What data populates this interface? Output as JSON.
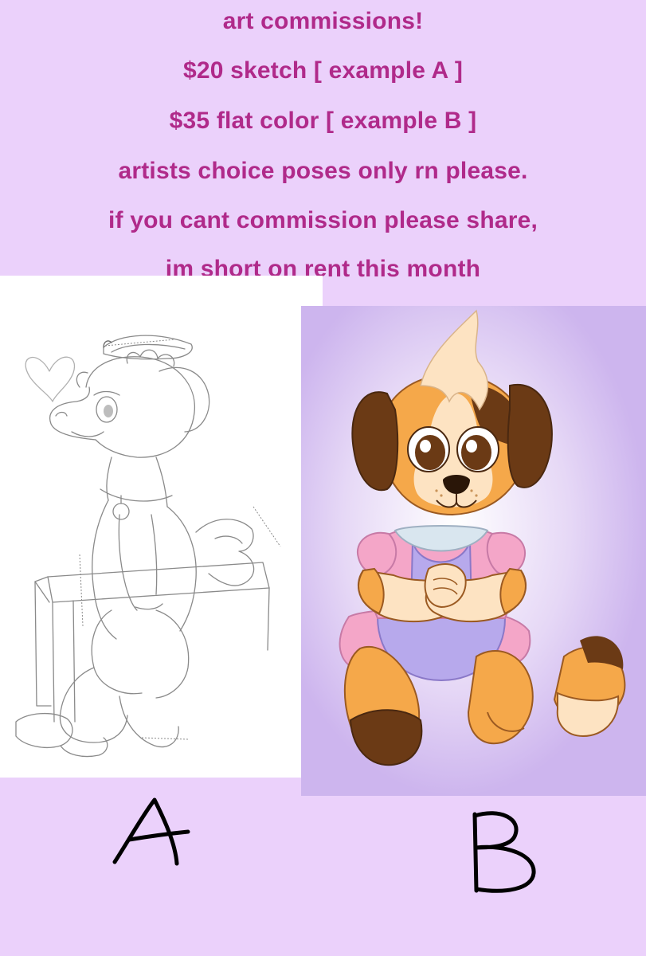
{
  "header": {
    "lines": [
      "art commissions!",
      "$20 sketch [ example A ]",
      "$35 flat color [ example B ]",
      "artists choice poses only rn please.",
      "if you cant commission please share,",
      "im short on rent this month"
    ]
  },
  "examples": {
    "a_label": "A",
    "b_label": "B"
  },
  "colors": {
    "background": "#ebd1fb",
    "text": "#b02a8a",
    "panel_a": "#ffffff",
    "panel_b": "#f2ecfb"
  }
}
